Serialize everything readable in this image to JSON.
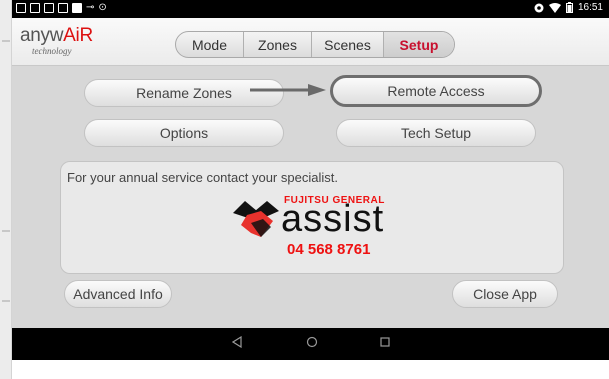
{
  "status_bar": {
    "time": "16:51",
    "left_icons": [
      "image-icon",
      "image-icon",
      "image-icon",
      "image-icon",
      "square-icon",
      "usb-icon",
      "info-icon"
    ],
    "right_icons": [
      "location-icon",
      "wifi-icon",
      "battery-icon"
    ]
  },
  "logo": {
    "brand_prefix": "anyw",
    "brand_suffix": "AiR",
    "subtitle": "technology"
  },
  "tabs": [
    {
      "label": "Mode",
      "active": false
    },
    {
      "label": "Zones",
      "active": false
    },
    {
      "label": "Scenes",
      "active": false
    },
    {
      "label": "Setup",
      "active": true
    }
  ],
  "buttons": {
    "rename_zones": "Rename Zones",
    "remote_access": "Remote Access",
    "options": "Options",
    "tech_setup": "Tech Setup",
    "advanced_info": "Advanced Info",
    "close_app": "Close App"
  },
  "service_panel": {
    "message": "For your annual service contact your specialist.",
    "brand_name": "FUJITSU GENERAL",
    "assist_word": "assist",
    "phone": "04 568 8761"
  },
  "nav_bar": {
    "back_icon": "triangle-back-icon",
    "home_icon": "circle-home-icon",
    "recents_icon": "square-recents-icon"
  },
  "colors": {
    "accent_red": "#c8102e",
    "background": "#d7d7d7"
  }
}
